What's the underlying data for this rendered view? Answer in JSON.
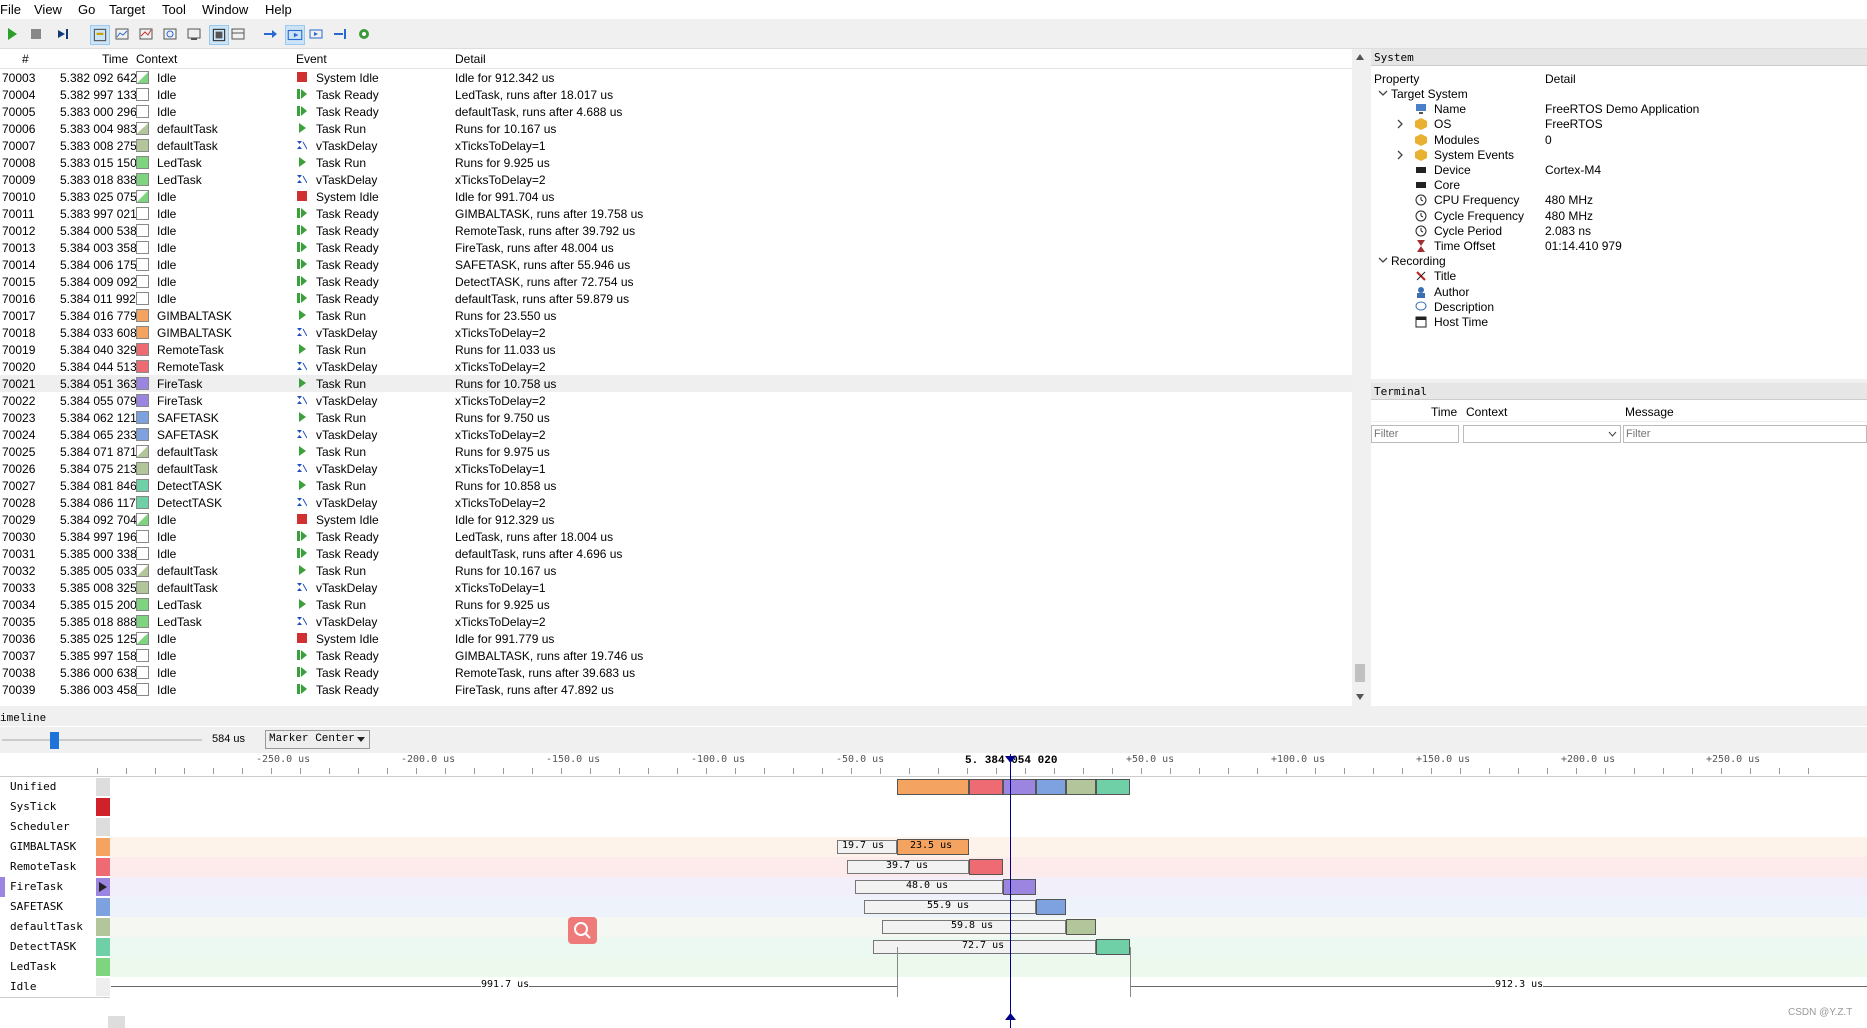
{
  "menu": [
    "File",
    "View",
    "Go",
    "Target",
    "Tool",
    "Window",
    "Help"
  ],
  "events": {
    "headers": {
      "num": "#",
      "time": "Time",
      "context": "Context",
      "event": "Event",
      "detail": "Detail"
    },
    "rows": [
      {
        "n": "70003",
        "t": "5.382 092 642",
        "c": "Idle",
        "e": "System Idle",
        "d": "Idle for 912.342 us"
      },
      {
        "n": "70004",
        "t": "5.382 997 133",
        "c": "Idle",
        "e": "Task Ready",
        "d": "LedTask, runs after 18.017 us"
      },
      {
        "n": "70005",
        "t": "5.383 000 296",
        "c": "Idle",
        "e": "Task Ready",
        "d": "defaultTask, runs after 4.688 us"
      },
      {
        "n": "70006",
        "t": "5.383 004 983",
        "c": "defaultTask",
        "e": "Task Run",
        "d": "Runs for 10.167 us"
      },
      {
        "n": "70007",
        "t": "5.383 008 275",
        "c": "defaultTask",
        "e": "vTaskDelay",
        "d": "xTicksToDelay=1"
      },
      {
        "n": "70008",
        "t": "5.383 015 150",
        "c": "LedTask",
        "e": "Task Run",
        "d": "Runs for 9.925 us"
      },
      {
        "n": "70009",
        "t": "5.383 018 838",
        "c": "LedTask",
        "e": "vTaskDelay",
        "d": "xTicksToDelay=2"
      },
      {
        "n": "70010",
        "t": "5.383 025 075",
        "c": "Idle",
        "e": "System Idle",
        "d": "Idle for 991.704 us"
      },
      {
        "n": "70011",
        "t": "5.383 997 021",
        "c": "Idle",
        "e": "Task Ready",
        "d": "GIMBALTASK, runs after 19.758 us"
      },
      {
        "n": "70012",
        "t": "5.384 000 538",
        "c": "Idle",
        "e": "Task Ready",
        "d": "RemoteTask, runs after 39.792 us"
      },
      {
        "n": "70013",
        "t": "5.384 003 358",
        "c": "Idle",
        "e": "Task Ready",
        "d": "FireTask, runs after 48.004 us"
      },
      {
        "n": "70014",
        "t": "5.384 006 175",
        "c": "Idle",
        "e": "Task Ready",
        "d": "SAFETASK, runs after 55.946 us"
      },
      {
        "n": "70015",
        "t": "5.384 009 092",
        "c": "Idle",
        "e": "Task Ready",
        "d": "DetectTASK, runs after 72.754 us"
      },
      {
        "n": "70016",
        "t": "5.384 011 992",
        "c": "Idle",
        "e": "Task Ready",
        "d": "defaultTask, runs after 59.879 us"
      },
      {
        "n": "70017",
        "t": "5.384 016 779",
        "c": "GIMBALTASK",
        "e": "Task Run",
        "d": "Runs for 23.550 us"
      },
      {
        "n": "70018",
        "t": "5.384 033 608",
        "c": "GIMBALTASK",
        "e": "vTaskDelay",
        "d": "xTicksToDelay=2"
      },
      {
        "n": "70019",
        "t": "5.384 040 329",
        "c": "RemoteTask",
        "e": "Task Run",
        "d": "Runs for 11.033 us"
      },
      {
        "n": "70020",
        "t": "5.384 044 513",
        "c": "RemoteTask",
        "e": "vTaskDelay",
        "d": "xTicksToDelay=2"
      },
      {
        "n": "70021",
        "t": "5.384 051 363",
        "c": "FireTask",
        "e": "Task Run",
        "d": "Runs for 10.758 us"
      },
      {
        "n": "70022",
        "t": "5.384 055 079",
        "c": "FireTask",
        "e": "vTaskDelay",
        "d": "xTicksToDelay=2"
      },
      {
        "n": "70023",
        "t": "5.384 062 121",
        "c": "SAFETASK",
        "e": "Task Run",
        "d": "Runs for 9.750 us"
      },
      {
        "n": "70024",
        "t": "5.384 065 233",
        "c": "SAFETASK",
        "e": "vTaskDelay",
        "d": "xTicksToDelay=2"
      },
      {
        "n": "70025",
        "t": "5.384 071 871",
        "c": "defaultTask",
        "e": "Task Run",
        "d": "Runs for 9.975 us"
      },
      {
        "n": "70026",
        "t": "5.384 075 213",
        "c": "defaultTask",
        "e": "vTaskDelay",
        "d": "xTicksToDelay=1"
      },
      {
        "n": "70027",
        "t": "5.384 081 846",
        "c": "DetectTASK",
        "e": "Task Run",
        "d": "Runs for 10.858 us"
      },
      {
        "n": "70028",
        "t": "5.384 086 117",
        "c": "DetectTASK",
        "e": "vTaskDelay",
        "d": "xTicksToDelay=2"
      },
      {
        "n": "70029",
        "t": "5.384 092 704",
        "c": "Idle",
        "e": "System Idle",
        "d": "Idle for 912.329 us"
      },
      {
        "n": "70030",
        "t": "5.384 997 196",
        "c": "Idle",
        "e": "Task Ready",
        "d": "LedTask, runs after 18.004 us"
      },
      {
        "n": "70031",
        "t": "5.385 000 338",
        "c": "Idle",
        "e": "Task Ready",
        "d": "defaultTask, runs after 4.696 us"
      },
      {
        "n": "70032",
        "t": "5.385 005 033",
        "c": "defaultTask",
        "e": "Task Run",
        "d": "Runs for 10.167 us"
      },
      {
        "n": "70033",
        "t": "5.385 008 325",
        "c": "defaultTask",
        "e": "vTaskDelay",
        "d": "xTicksToDelay=1"
      },
      {
        "n": "70034",
        "t": "5.385 015 200",
        "c": "LedTask",
        "e": "Task Run",
        "d": "Runs for 9.925 us"
      },
      {
        "n": "70035",
        "t": "5.385 018 888",
        "c": "LedTask",
        "e": "vTaskDelay",
        "d": "xTicksToDelay=2"
      },
      {
        "n": "70036",
        "t": "5.385 025 125",
        "c": "Idle",
        "e": "System Idle",
        "d": "Idle for 991.779 us"
      },
      {
        "n": "70037",
        "t": "5.385 997 158",
        "c": "Idle",
        "e": "Task Ready",
        "d": "GIMBALTASK, runs after 19.746 us"
      },
      {
        "n": "70038",
        "t": "5.386 000 638",
        "c": "Idle",
        "e": "Task Ready",
        "d": "RemoteTask, runs after 39.683 us"
      },
      {
        "n": "70039",
        "t": "5.386 003 458",
        "c": "Idle",
        "e": "Task Ready",
        "d": "FireTask, runs after 47.892 us"
      }
    ],
    "highlighted_row": "70021"
  },
  "context_colors": {
    "Idle": "#ffffff",
    "defaultTask": "#b3c59a",
    "LedTask": "#7fd480",
    "GIMBALTASK": "#f4a460",
    "RemoteTask": "#ef6b73",
    "FireTask": "#9b85e0",
    "SAFETASK": "#7ea2e0",
    "DetectTASK": "#6fd0a8"
  },
  "system": {
    "title": "System",
    "col_property": "Property",
    "col_detail": "Detail",
    "items": [
      {
        "label": "Target System",
        "value": "",
        "level": 0,
        "expander": "v",
        "icon": "none"
      },
      {
        "label": "Name",
        "value": "FreeRTOS Demo Application",
        "level": 1,
        "expander": "",
        "icon": "monitor-icon"
      },
      {
        "label": "OS",
        "value": "FreeRTOS",
        "level": 1,
        "expander": ">",
        "icon": "cube-icon"
      },
      {
        "label": "Modules",
        "value": "0",
        "level": 1,
        "expander": "",
        "icon": "cube-icon"
      },
      {
        "label": "System Events",
        "value": "",
        "level": 1,
        "expander": ">",
        "icon": "cube-icon"
      },
      {
        "label": "Device",
        "value": "Cortex-M4",
        "level": 1,
        "expander": "",
        "icon": "chip-icon"
      },
      {
        "label": "Core",
        "value": "",
        "level": 1,
        "expander": "",
        "icon": "chip-icon"
      },
      {
        "label": "CPU Frequency",
        "value": "480 MHz",
        "level": 1,
        "expander": "",
        "icon": "clock-icon"
      },
      {
        "label": "Cycle Frequency",
        "value": "480 MHz",
        "level": 1,
        "expander": "",
        "icon": "clock-icon"
      },
      {
        "label": "Cycle Period",
        "value": "2.083 ns",
        "level": 1,
        "expander": "",
        "icon": "clock-icon"
      },
      {
        "label": "Time Offset",
        "value": "01:14.410 979",
        "level": 1,
        "expander": "",
        "icon": "hourglass-icon"
      },
      {
        "label": "Recording",
        "value": "",
        "level": 0,
        "expander": "v",
        "icon": "none"
      },
      {
        "label": "Title",
        "value": "",
        "level": 1,
        "expander": "",
        "icon": "title-icon"
      },
      {
        "label": "Author",
        "value": "",
        "level": 1,
        "expander": "",
        "icon": "person-icon"
      },
      {
        "label": "Description",
        "value": "",
        "level": 1,
        "expander": "",
        "icon": "chat-icon"
      },
      {
        "label": "Host Time",
        "value": "",
        "level": 1,
        "expander": "",
        "icon": "window-icon"
      }
    ]
  },
  "terminal": {
    "title": "Terminal",
    "col_time": "Time",
    "col_context": "Context",
    "col_message": "Message",
    "filter_placeholder": "Filter"
  },
  "timeline": {
    "title": "imeline",
    "zoom_label": "584 us",
    "zoom_fraction": 0.26,
    "mode": "Marker Center",
    "center_time": "5. 384 054 020",
    "ticks": [
      "-250.0 us",
      "-200.0 us",
      "-150.0 us",
      "-100.0 us",
      "-50.0 us",
      "+50.0 us",
      "+100.0 us",
      "+150.0 us",
      "+200.0 us",
      "+250.0 us"
    ],
    "tracks": [
      {
        "name": "Unified",
        "color": "#dddddd"
      },
      {
        "name": "SysTick",
        "color": "#d0202a"
      },
      {
        "name": "Scheduler",
        "color": "#dddddd"
      },
      {
        "name": "GIMBALTASK",
        "color": "#f4a460"
      },
      {
        "name": "RemoteTask",
        "color": "#ef6b73"
      },
      {
        "name": "FireTask",
        "color": "#9b85e0"
      },
      {
        "name": "SAFETASK",
        "color": "#7ea2e0"
      },
      {
        "name": "defaultTask",
        "color": "#b3c59a"
      },
      {
        "name": "DetectTASK",
        "color": "#6fd0a8"
      },
      {
        "name": "LedTask",
        "color": "#7fd480"
      },
      {
        "name": "Idle",
        "color": "#eeeeee"
      }
    ],
    "wait_labels": [
      "19.7 us",
      "23.5 us",
      "39.7 us",
      "48.0 us",
      "55.9 us",
      "59.8 us",
      "72.7 us"
    ],
    "idle_labels": [
      "991.7 us",
      "912.3 us"
    ],
    "watermark": "CSDN @Y.Z.T"
  }
}
